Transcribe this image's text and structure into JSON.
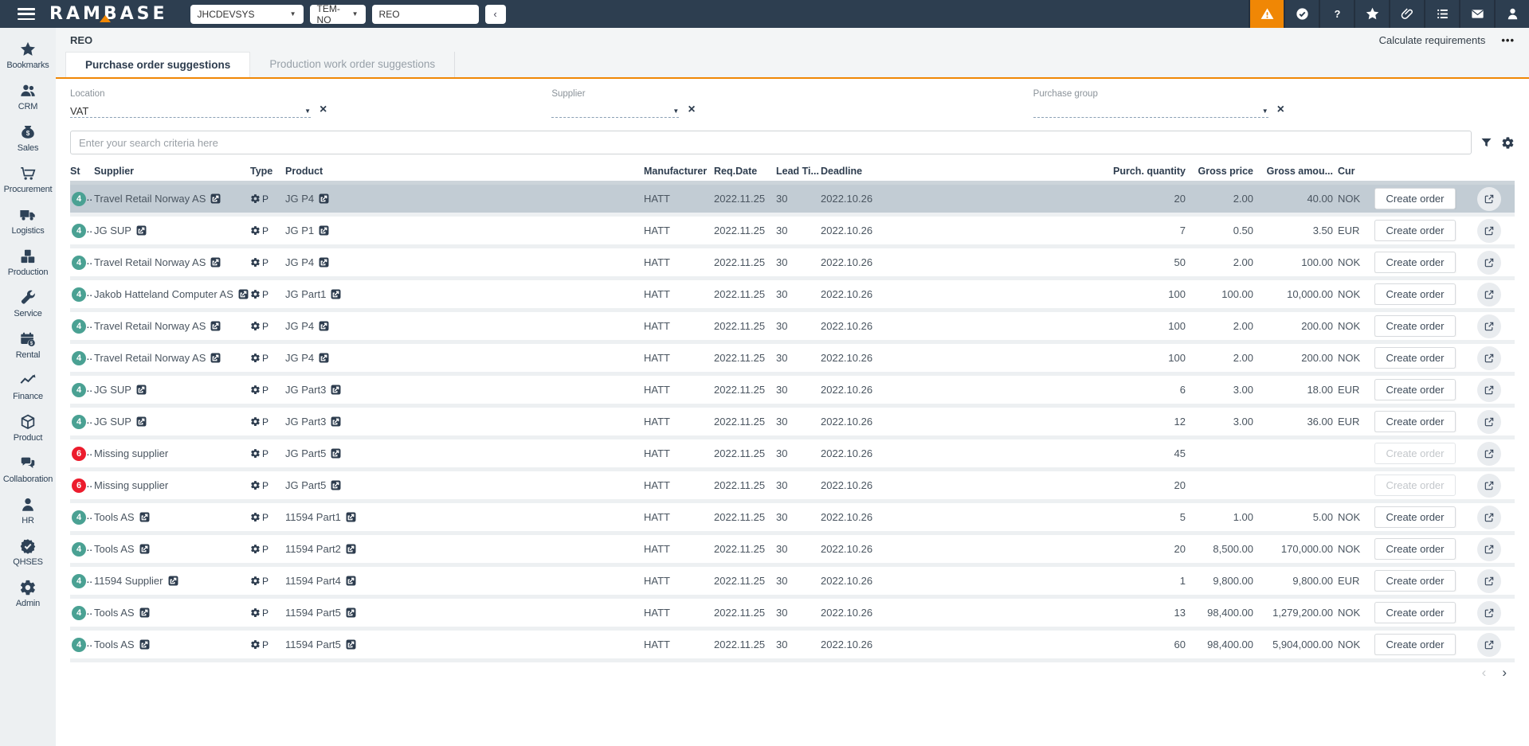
{
  "topbar": {
    "brand": "RAMBASE",
    "system": "JHCDEVSYS",
    "module": "TEM-NO",
    "search_value": "REO",
    "collapse_label": "‹",
    "icons": [
      {
        "name": "alerts",
        "icon": "warning",
        "accent": true
      },
      {
        "name": "approvals",
        "icon": "check"
      },
      {
        "name": "help",
        "icon": "question"
      },
      {
        "name": "favorites",
        "icon": "star"
      },
      {
        "name": "attachments",
        "icon": "paperclip"
      },
      {
        "name": "menu",
        "icon": "list"
      },
      {
        "name": "messages",
        "icon": "mail"
      },
      {
        "name": "account",
        "icon": "user"
      }
    ]
  },
  "sidebar": {
    "items": [
      {
        "label": "Bookmarks",
        "icon": "star"
      },
      {
        "label": "CRM",
        "icon": "users"
      },
      {
        "label": "Sales",
        "icon": "moneybag"
      },
      {
        "label": "Procurement",
        "icon": "cart"
      },
      {
        "label": "Logistics",
        "icon": "truck"
      },
      {
        "label": "Production",
        "icon": "cubes"
      },
      {
        "label": "Service",
        "icon": "wrench"
      },
      {
        "label": "Rental",
        "icon": "calendar"
      },
      {
        "label": "Finance",
        "icon": "chart"
      },
      {
        "label": "Product",
        "icon": "cube"
      },
      {
        "label": "Collaboration",
        "icon": "chat"
      },
      {
        "label": "HR",
        "icon": "person"
      },
      {
        "label": "QHSES",
        "icon": "badge"
      },
      {
        "label": "Admin",
        "icon": "gear"
      }
    ]
  },
  "page": {
    "breadcrumb": "REO",
    "calculate_label": "Calculate requirements",
    "more_label": "•••",
    "tabs": [
      {
        "label": "Purchase order suggestions",
        "active": true
      },
      {
        "label": "Production work order suggestions",
        "active": false
      }
    ],
    "filters": [
      {
        "label": "Location",
        "value": "VAT"
      },
      {
        "label": "Supplier",
        "value": ""
      },
      {
        "label": "Purchase group",
        "value": ""
      }
    ],
    "search_placeholder": "Enter your search criteria here"
  },
  "table": {
    "columns": {
      "st": "St",
      "supplier": "Supplier",
      "type": "Type",
      "product": "Product",
      "manufacturer": "Manufacturer",
      "req_date": "Req.Date",
      "lead_time": "Lead Ti...",
      "deadline": "Deadline",
      "qty": "Purch. quantity",
      "price": "Gross price",
      "amount": "Gross amou...",
      "cur": "Cur"
    },
    "create_order_label": "Create order",
    "status_suffix": "..",
    "rows": [
      {
        "st": "4",
        "sc": "ok",
        "supplier": "Travel Retail Norway AS",
        "slink": true,
        "type": "P",
        "product": "JG P4",
        "manufacturer": "HATT",
        "req_date": "2022.11.25",
        "lead_time": "30",
        "deadline": "2022.10.26",
        "qty": "20",
        "price": "2.00",
        "amount": "40.00",
        "cur": "NOK",
        "selected": true,
        "disabled": false
      },
      {
        "st": "4",
        "sc": "ok",
        "supplier": "JG SUP",
        "slink": true,
        "type": "P",
        "product": "JG P1",
        "manufacturer": "HATT",
        "req_date": "2022.11.25",
        "lead_time": "30",
        "deadline": "2022.10.26",
        "qty": "7",
        "price": "0.50",
        "amount": "3.50",
        "cur": "EUR",
        "selected": false,
        "disabled": false
      },
      {
        "st": "4",
        "sc": "ok",
        "supplier": "Travel Retail Norway AS",
        "slink": true,
        "type": "P",
        "product": "JG P4",
        "manufacturer": "HATT",
        "req_date": "2022.11.25",
        "lead_time": "30",
        "deadline": "2022.10.26",
        "qty": "50",
        "price": "2.00",
        "amount": "100.00",
        "cur": "NOK",
        "selected": false,
        "disabled": false
      },
      {
        "st": "4",
        "sc": "ok",
        "supplier": "Jakob Hatteland Computer AS",
        "slink": true,
        "type": "P",
        "product": "JG Part1",
        "manufacturer": "HATT",
        "req_date": "2022.11.25",
        "lead_time": "30",
        "deadline": "2022.10.26",
        "qty": "100",
        "price": "100.00",
        "amount": "10,000.00",
        "cur": "NOK",
        "selected": false,
        "disabled": false
      },
      {
        "st": "4",
        "sc": "ok",
        "supplier": "Travel Retail Norway AS",
        "slink": true,
        "type": "P",
        "product": "JG P4",
        "manufacturer": "HATT",
        "req_date": "2022.11.25",
        "lead_time": "30",
        "deadline": "2022.10.26",
        "qty": "100",
        "price": "2.00",
        "amount": "200.00",
        "cur": "NOK",
        "selected": false,
        "disabled": false
      },
      {
        "st": "4",
        "sc": "ok",
        "supplier": "Travel Retail Norway AS",
        "slink": true,
        "type": "P",
        "product": "JG P4",
        "manufacturer": "HATT",
        "req_date": "2022.11.25",
        "lead_time": "30",
        "deadline": "2022.10.26",
        "qty": "100",
        "price": "2.00",
        "amount": "200.00",
        "cur": "NOK",
        "selected": false,
        "disabled": false
      },
      {
        "st": "4",
        "sc": "ok",
        "supplier": "JG SUP",
        "slink": true,
        "type": "P",
        "product": "JG Part3",
        "manufacturer": "HATT",
        "req_date": "2022.11.25",
        "lead_time": "30",
        "deadline": "2022.10.26",
        "qty": "6",
        "price": "3.00",
        "amount": "18.00",
        "cur": "EUR",
        "selected": false,
        "disabled": false
      },
      {
        "st": "4",
        "sc": "ok",
        "supplier": "JG SUP",
        "slink": true,
        "type": "P",
        "product": "JG Part3",
        "manufacturer": "HATT",
        "req_date": "2022.11.25",
        "lead_time": "30",
        "deadline": "2022.10.26",
        "qty": "12",
        "price": "3.00",
        "amount": "36.00",
        "cur": "EUR",
        "selected": false,
        "disabled": false
      },
      {
        "st": "6",
        "sc": "err",
        "supplier": "Missing supplier",
        "slink": false,
        "type": "P",
        "product": "JG Part5",
        "manufacturer": "HATT",
        "req_date": "2022.11.25",
        "lead_time": "30",
        "deadline": "2022.10.26",
        "qty": "45",
        "price": "",
        "amount": "",
        "cur": "",
        "selected": false,
        "disabled": true
      },
      {
        "st": "6",
        "sc": "err",
        "supplier": "Missing supplier",
        "slink": false,
        "type": "P",
        "product": "JG Part5",
        "manufacturer": "HATT",
        "req_date": "2022.11.25",
        "lead_time": "30",
        "deadline": "2022.10.26",
        "qty": "20",
        "price": "",
        "amount": "",
        "cur": "",
        "selected": false,
        "disabled": true
      },
      {
        "st": "4",
        "sc": "ok",
        "supplier": "Tools AS",
        "slink": true,
        "type": "P",
        "product": "11594 Part1",
        "manufacturer": "HATT",
        "req_date": "2022.11.25",
        "lead_time": "30",
        "deadline": "2022.10.26",
        "qty": "5",
        "price": "1.00",
        "amount": "5.00",
        "cur": "NOK",
        "selected": false,
        "disabled": false
      },
      {
        "st": "4",
        "sc": "ok",
        "supplier": "Tools AS",
        "slink": true,
        "type": "P",
        "product": "11594 Part2",
        "manufacturer": "HATT",
        "req_date": "2022.11.25",
        "lead_time": "30",
        "deadline": "2022.10.26",
        "qty": "20",
        "price": "8,500.00",
        "amount": "170,000.00",
        "cur": "NOK",
        "selected": false,
        "disabled": false
      },
      {
        "st": "4",
        "sc": "ok",
        "supplier": "11594 Supplier",
        "slink": true,
        "type": "P",
        "product": "11594 Part4",
        "manufacturer": "HATT",
        "req_date": "2022.11.25",
        "lead_time": "30",
        "deadline": "2022.10.26",
        "qty": "1",
        "price": "9,800.00",
        "amount": "9,800.00",
        "cur": "EUR",
        "selected": false,
        "disabled": false
      },
      {
        "st": "4",
        "sc": "ok",
        "supplier": "Tools AS",
        "slink": true,
        "type": "P",
        "product": "11594 Part5",
        "manufacturer": "HATT",
        "req_date": "2022.11.25",
        "lead_time": "30",
        "deadline": "2022.10.26",
        "qty": "13",
        "price": "98,400.00",
        "amount": "1,279,200.00",
        "cur": "NOK",
        "selected": false,
        "disabled": false
      },
      {
        "st": "4",
        "sc": "ok",
        "supplier": "Tools AS",
        "slink": true,
        "type": "P",
        "product": "11594 Part5",
        "manufacturer": "HATT",
        "req_date": "2022.11.25",
        "lead_time": "30",
        "deadline": "2022.10.26",
        "qty": "60",
        "price": "98,400.00",
        "amount": "5,904,000.00",
        "cur": "NOK",
        "selected": false,
        "disabled": false
      }
    ]
  },
  "pagination": {
    "prev": "‹",
    "next": "›"
  },
  "colors": {
    "accent_orange": "#f08705",
    "topbar_navy": "#2d3e50",
    "status_ok": "#4aa193",
    "status_error": "#ec1c2d",
    "selected_row": "#c2ccd4"
  }
}
